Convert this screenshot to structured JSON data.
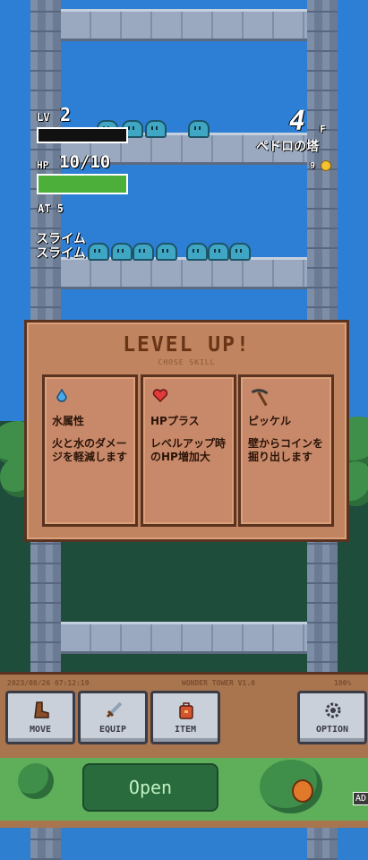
{
  "hud": {
    "level_label": "LV",
    "level_value": "2",
    "hp_label": "HP",
    "hp_value": "10/10",
    "hp_fraction": 1.0,
    "exp_fraction": 0.0,
    "attack": "AT 5",
    "floor_number": "4",
    "floor_suffix": "F",
    "tower_name": "ペドロの塔",
    "coins": "9",
    "log_lines": [
      "スライム",
      "スライム"
    ]
  },
  "level_up": {
    "title": "LEVEL UP!",
    "subtitle": "CHOSE SKILL",
    "cards": [
      {
        "icon": "water-drop-icon",
        "name": "水属性",
        "desc": "火と水のダメージを軽減します"
      },
      {
        "icon": "heart-icon",
        "name": "HPプラス",
        "desc": "レベルアップ時のHP増加大"
      },
      {
        "icon": "pickaxe-icon",
        "name": "ピッケル",
        "desc": "壁からコインを掘り出します"
      }
    ]
  },
  "status_bar": {
    "datetime": "2023/08/26 07:12:19",
    "version": "WONDER TOWER V1.0",
    "battery": "100%"
  },
  "toolbar": {
    "move": "MOVE",
    "equip": "EQUIP",
    "item": "ITEM",
    "option": "OPTION"
  },
  "ad": {
    "open_label": "Open",
    "badge": "AD"
  },
  "colors": {
    "sky": "#2c7fd4",
    "hp_bar": "#4caf3a",
    "panel": "#c08560",
    "title": "#6a3517"
  }
}
